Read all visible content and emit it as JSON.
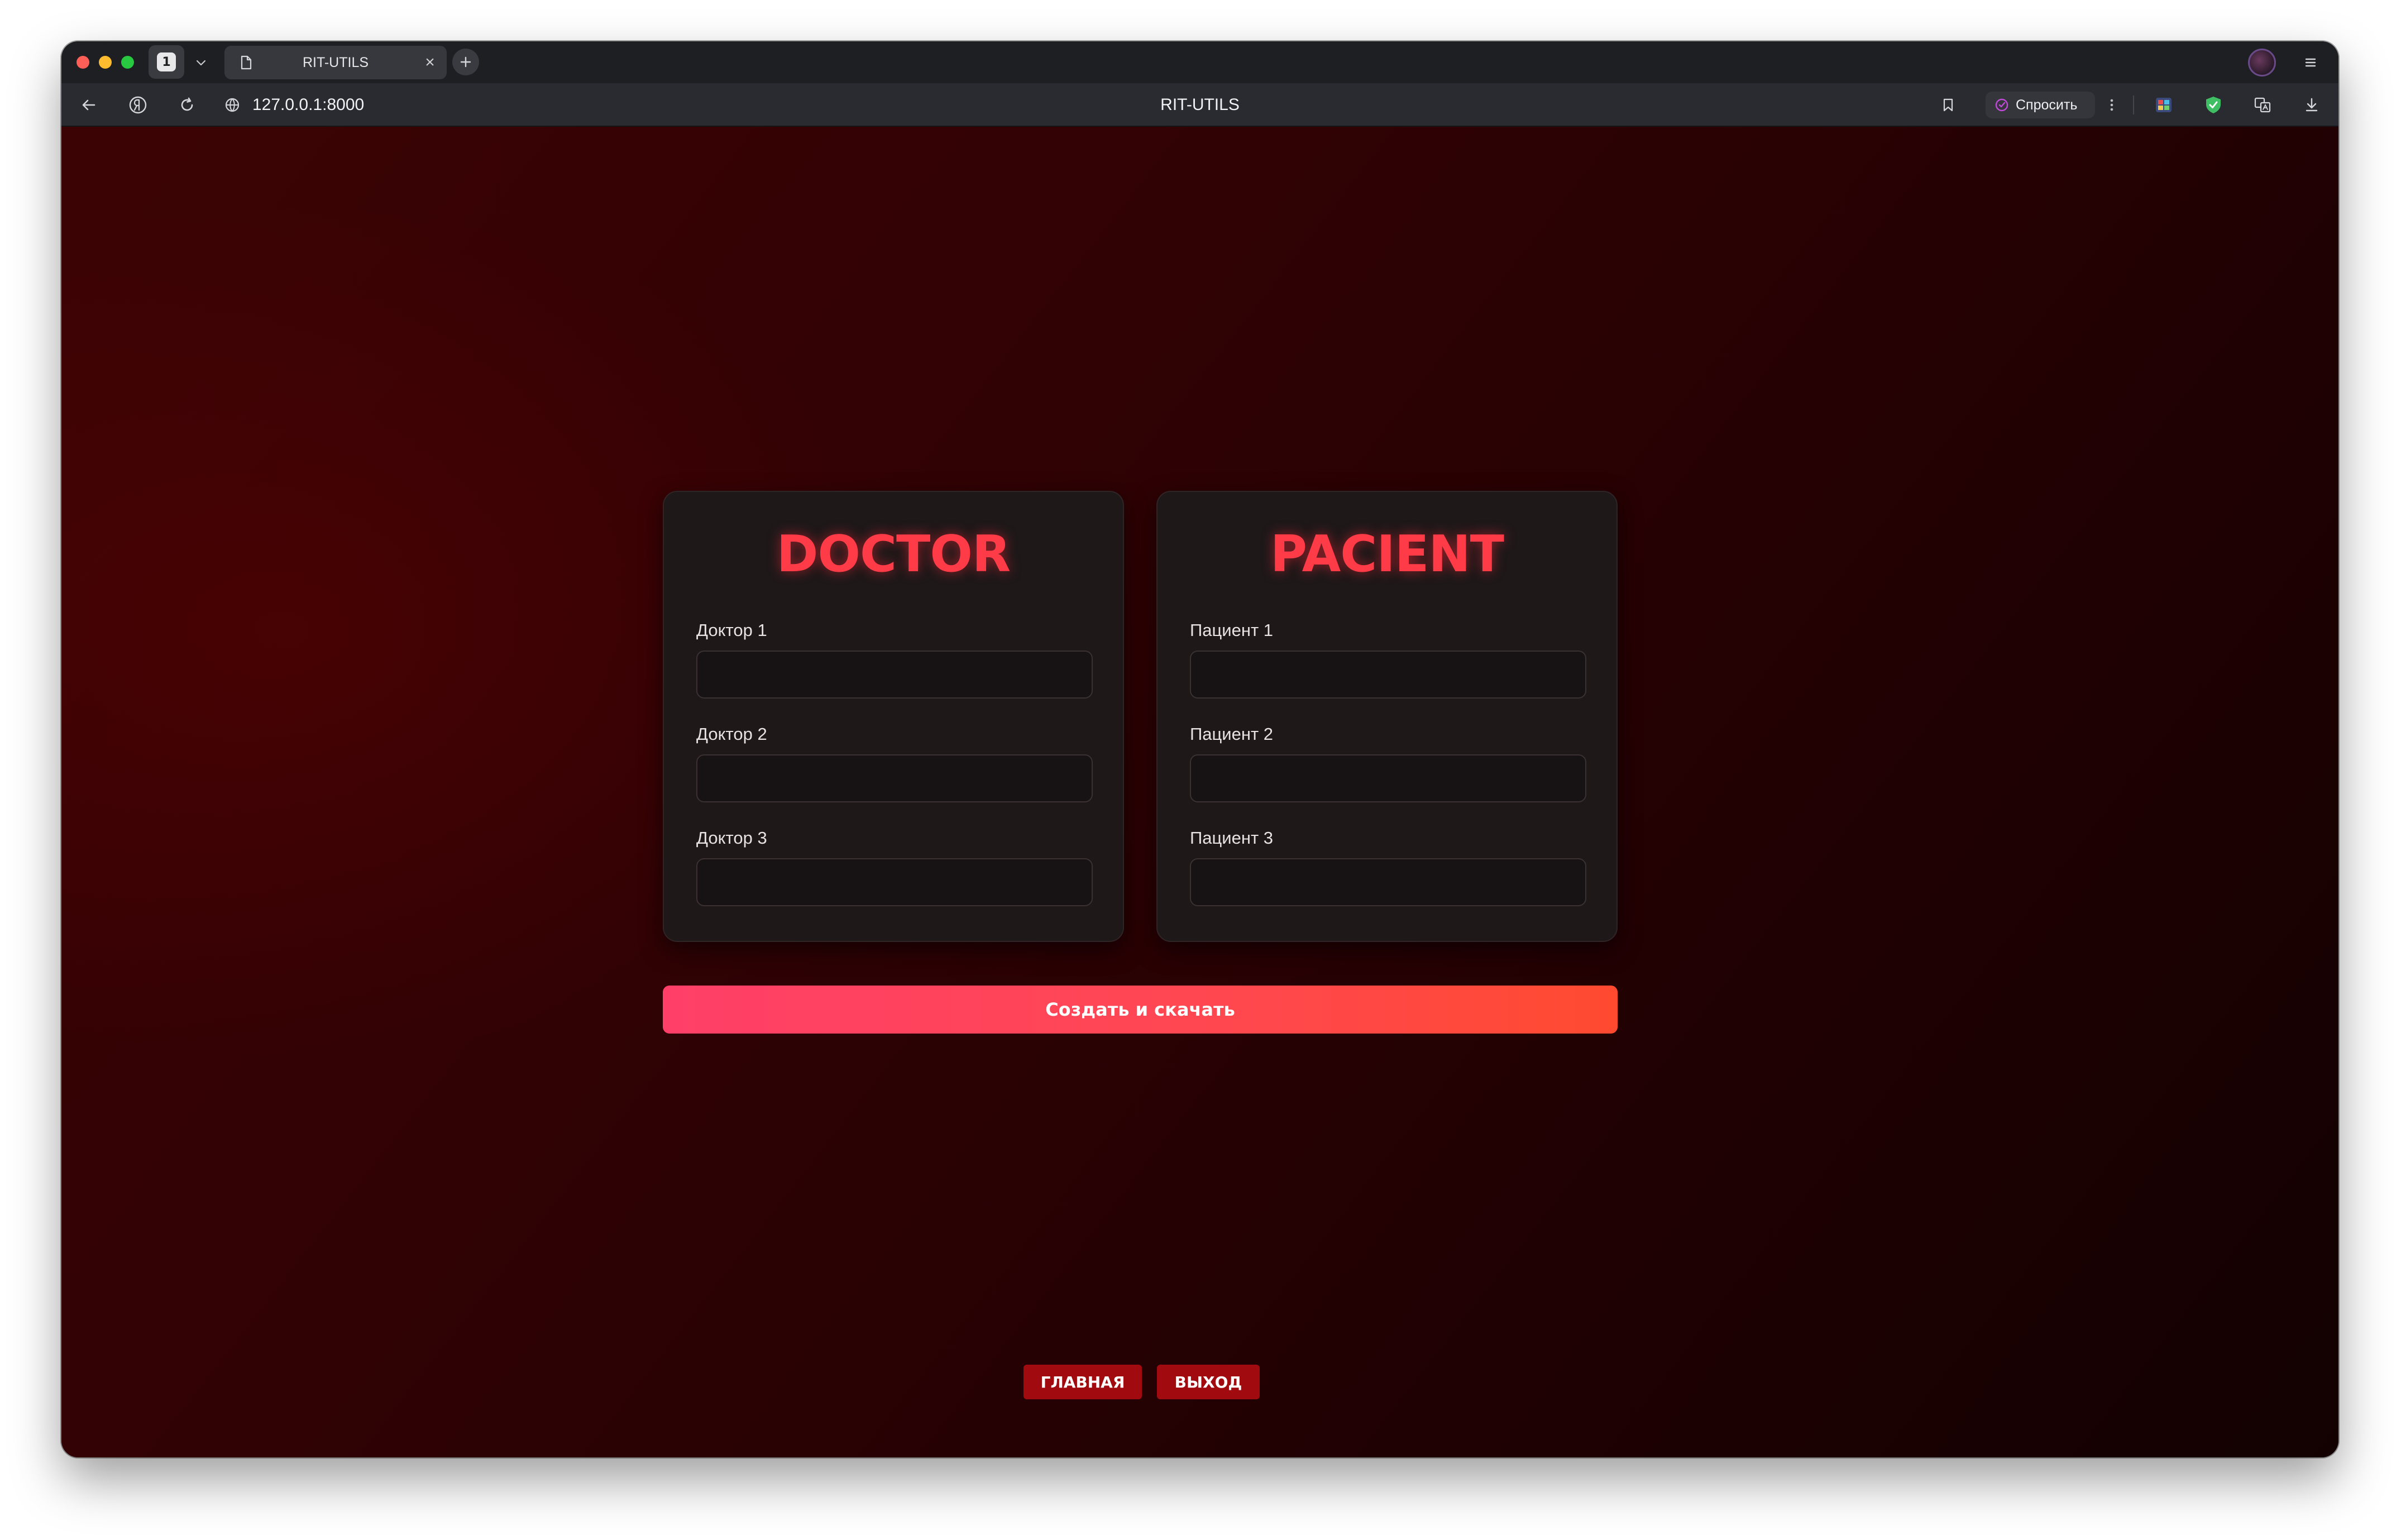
{
  "browser": {
    "tab_count": "1",
    "tab_title": "RIT-UTILS",
    "tab_close_glyph": "×",
    "url": "127.0.0.1:8000",
    "page_title": "RIT-UTILS",
    "ask_label": "Спросить",
    "icons": {
      "back": "arrow-left-icon",
      "yandex": "yandex-icon",
      "reload": "reload-icon",
      "site_info": "globe-icon",
      "bookmark": "bookmark-icon",
      "more": "more-vertical-icon",
      "extension": "extension-icon",
      "protect": "shield-check-icon",
      "translate": "translate-icon",
      "download": "download-icon",
      "menu": "menu-icon",
      "new_tab": "plus-icon"
    },
    "colors": {
      "traffic_red": "#ff5f57",
      "traffic_yellow": "#febc2e",
      "traffic_green": "#28c840",
      "shield": "#3fbf63"
    }
  },
  "doctor_form": {
    "heading": "DOCTOR",
    "fields": [
      {
        "label": "Доктор 1",
        "value": ""
      },
      {
        "label": "Доктор 2",
        "value": ""
      },
      {
        "label": "Доктор 3",
        "value": ""
      }
    ]
  },
  "patient_form": {
    "heading": "PACIENT",
    "fields": [
      {
        "label": "Пациент 1",
        "value": ""
      },
      {
        "label": "Пациент 2",
        "value": ""
      },
      {
        "label": "Пациент 3",
        "value": ""
      }
    ]
  },
  "actions": {
    "create_label": "Создать и скачать",
    "home_label": "ГЛАВНАЯ",
    "exit_label": "ВЫХОД"
  },
  "theme": {
    "accent": "#ff3b47",
    "button_gradient_start": "#ff3f68",
    "button_gradient_end": "#ff4a30",
    "nav_button": "#a10b0f"
  }
}
